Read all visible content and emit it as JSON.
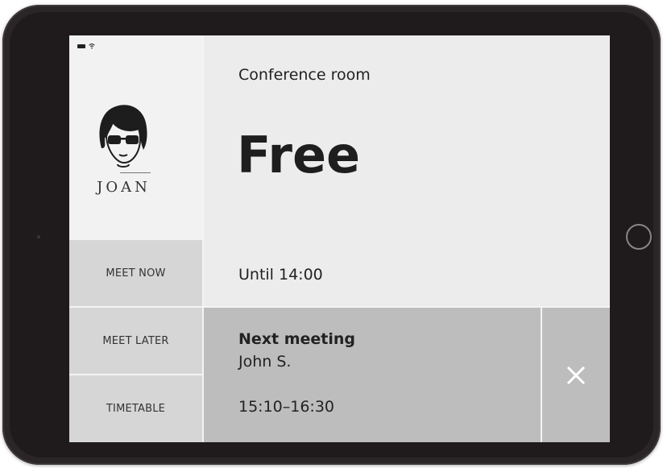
{
  "room": {
    "name": "Conference room",
    "status": "Free",
    "until": "Until 14:00"
  },
  "logo": {
    "text": "JOAN"
  },
  "sidebar": {
    "meet_now_label": "MEET NOW",
    "meet_later_label": "MEET LATER",
    "timetable_label": "TIMETABLE"
  },
  "next_meeting": {
    "title": "Next meeting",
    "organizer": "John S.",
    "time": "15:10–16:30"
  },
  "icons": {
    "status": [
      "battery-icon",
      "wifi-icon"
    ],
    "dismiss": "close-icon"
  },
  "colors": {
    "next_panel": "#bdbdbd",
    "screen_bg": "#ececec",
    "buttons": "#d6d6d6"
  }
}
